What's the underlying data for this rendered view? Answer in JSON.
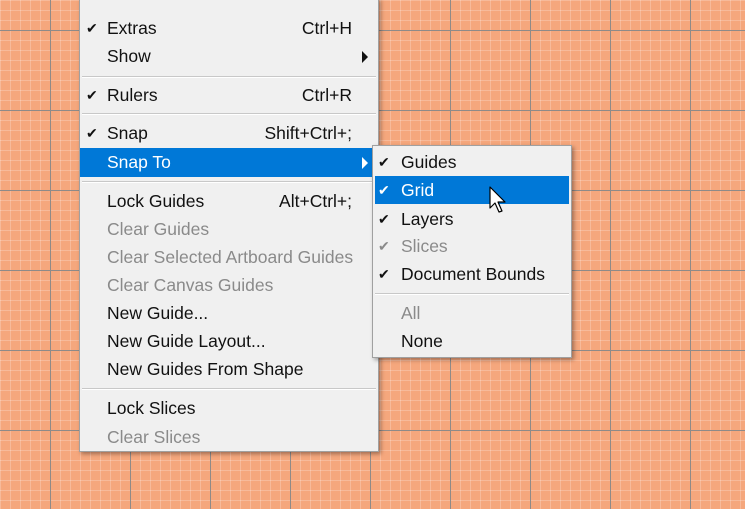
{
  "main_menu": {
    "items": [
      {
        "label": "Extras",
        "shortcut": "Ctrl+H",
        "checked": true,
        "disabled": false
      },
      {
        "label": "Show",
        "submenu": true,
        "disabled": false
      },
      {
        "label": "Rulers",
        "shortcut": "Ctrl+R",
        "checked": true,
        "disabled": false
      },
      {
        "label": "Snap",
        "shortcut": "Shift+Ctrl+;",
        "checked": true,
        "disabled": false
      },
      {
        "label": "Snap To",
        "submenu": true,
        "highlighted": true,
        "disabled": false
      },
      {
        "label": "Lock Guides",
        "shortcut": "Alt+Ctrl+;",
        "disabled": false
      },
      {
        "label": "Clear Guides",
        "disabled": true
      },
      {
        "label": "Clear Selected Artboard Guides",
        "disabled": true
      },
      {
        "label": "Clear Canvas Guides",
        "disabled": true
      },
      {
        "label": "New Guide...",
        "disabled": false
      },
      {
        "label": "New Guide Layout...",
        "disabled": false
      },
      {
        "label": "New Guides From Shape",
        "disabled": false
      },
      {
        "label": "Lock Slices",
        "disabled": false
      },
      {
        "label": "Clear Slices",
        "disabled": true
      }
    ]
  },
  "snap_to_submenu": {
    "items": [
      {
        "label": "Guides",
        "checked": true,
        "disabled": false
      },
      {
        "label": "Grid",
        "checked": true,
        "highlighted": true,
        "disabled": false
      },
      {
        "label": "Layers",
        "checked": true,
        "disabled": false
      },
      {
        "label": "Slices",
        "checked": true,
        "disabled": true
      },
      {
        "label": "Document Bounds",
        "checked": true,
        "disabled": false
      },
      {
        "label": "All",
        "disabled": true
      },
      {
        "label": "None",
        "disabled": false
      }
    ]
  },
  "icons": {
    "check": "checkmark-icon",
    "arrow": "submenu-arrow-icon",
    "cursor": "mouse-pointer-icon"
  },
  "colors": {
    "highlight": "#0078d7",
    "canvas": "#f5a77d",
    "menu_bg": "#f0f0f0",
    "disabled_text": "#8a8a8a"
  }
}
